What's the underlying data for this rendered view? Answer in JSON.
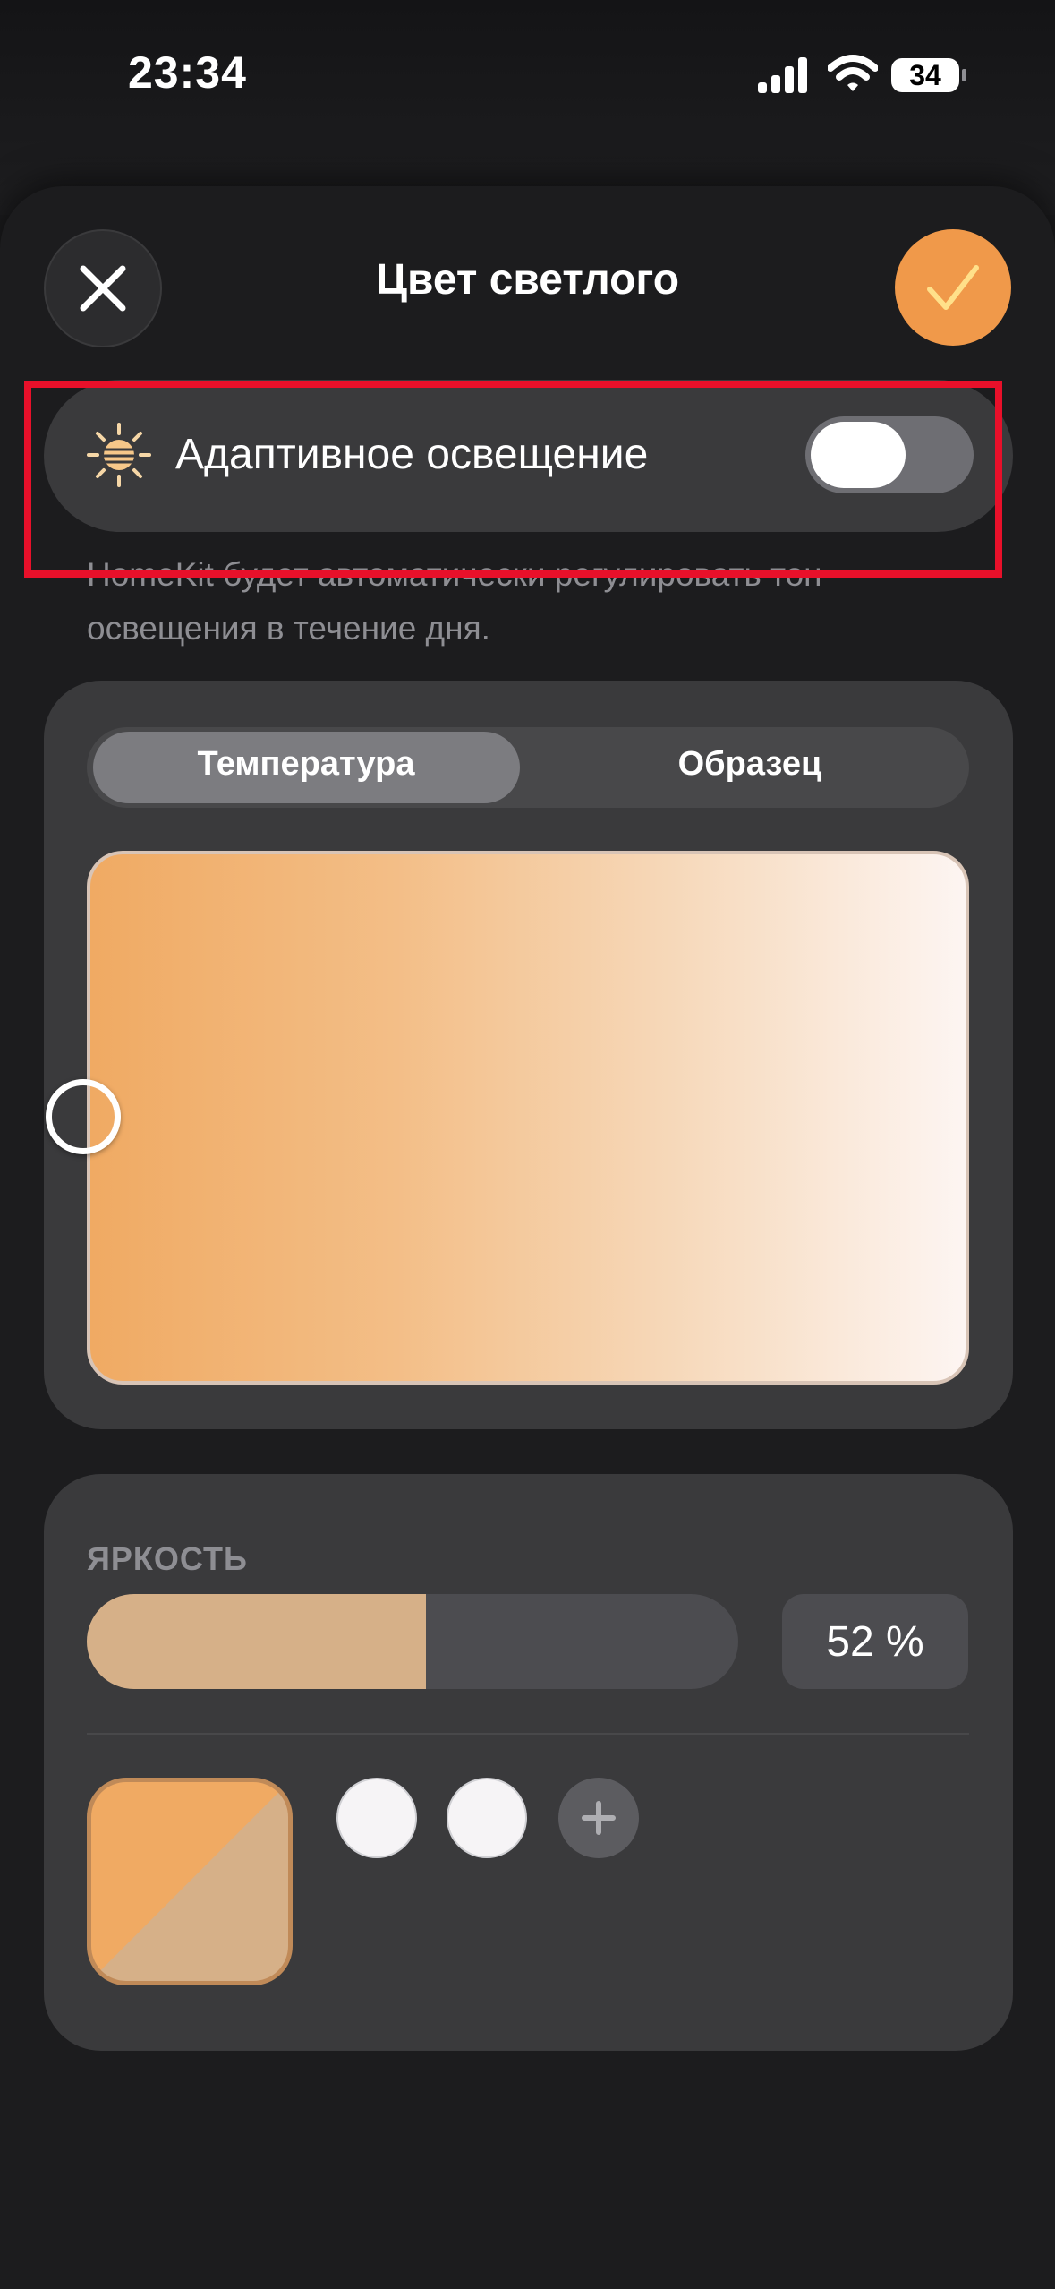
{
  "status_bar": {
    "time": "23:34",
    "battery": "34"
  },
  "header": {
    "title": "Цвет светлого"
  },
  "adaptive": {
    "label": "Адаптивное освещение",
    "enabled": false,
    "hint": "HomeKit будет автоматически регулировать тон освещения в течение дня."
  },
  "color_picker": {
    "tabs": [
      "Температура",
      "Образец"
    ],
    "selected_tab": "Температура"
  },
  "brightness": {
    "label": "ЯРКОСТЬ",
    "value": 52,
    "value_text": "52 %"
  },
  "colors": {
    "accent": "#f0994a",
    "highlight": "#e8102a",
    "warm": "#f0aa63",
    "brightness_fill": "#d6b088"
  },
  "icons": [
    "close-icon",
    "checkmark-icon",
    "sun-icon",
    "plus-icon",
    "signal-icon",
    "wifi-icon",
    "battery-icon"
  ]
}
